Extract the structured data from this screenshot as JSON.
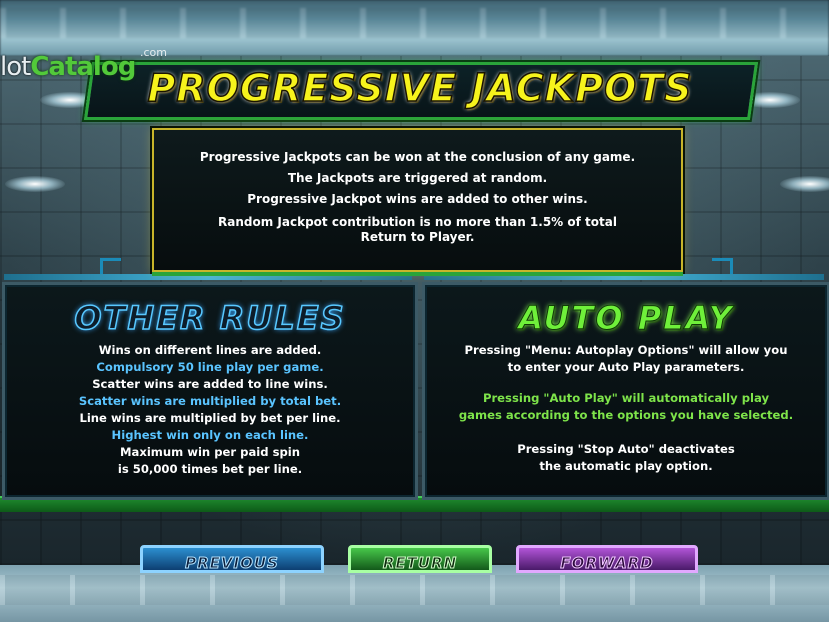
{
  "logo": {
    "part1": "lot",
    "part2": "Catalog",
    "suffix": ".com"
  },
  "title": "PROGRESSIVE JACKPOTS",
  "jackpot_info": [
    "Progressive Jackpots can be won at the conclusion of any game.",
    "The Jackpots are triggered at random.",
    "Progressive Jackpot wins are added to other wins.",
    "Random Jackpot contribution is no more than 1.5% of total",
    "Return to Player."
  ],
  "other_rules": {
    "heading": "OTHER RULES",
    "lines": [
      {
        "text": "Wins on different lines are added.",
        "highlight": false
      },
      {
        "text": "Compulsory 50 line play per game.",
        "highlight": true
      },
      {
        "text": "Scatter wins are added to line wins.",
        "highlight": false
      },
      {
        "text": "Scatter wins are multiplied by total bet.",
        "highlight": true
      },
      {
        "text": "Line wins are multiplied by bet per line.",
        "highlight": false
      },
      {
        "text": "Highest win only on each line.",
        "highlight": true
      },
      {
        "text": "Maximum win per paid spin",
        "highlight": false
      },
      {
        "text": "is 50,000 times bet per line.",
        "highlight": false
      }
    ]
  },
  "auto_play": {
    "heading": "AUTO PLAY",
    "lines": [
      "Pressing \"Menu: Autoplay Options\" will allow you",
      "to enter your Auto Play parameters.",
      "Pressing \"Auto Play\" will automatically play",
      "games according to the options you have selected.",
      "Pressing \"Stop Auto\" deactivates",
      "the automatic play option."
    ]
  },
  "nav": {
    "previous": "PREVIOUS",
    "return": "RETURN",
    "forward": "FORWARD"
  },
  "colors": {
    "title_yellow": "#f7f31c",
    "rule_highlight_blue": "#5ac4ff",
    "auto_heading_green": "#6ff03a",
    "frame_green": "#2aa43a"
  }
}
